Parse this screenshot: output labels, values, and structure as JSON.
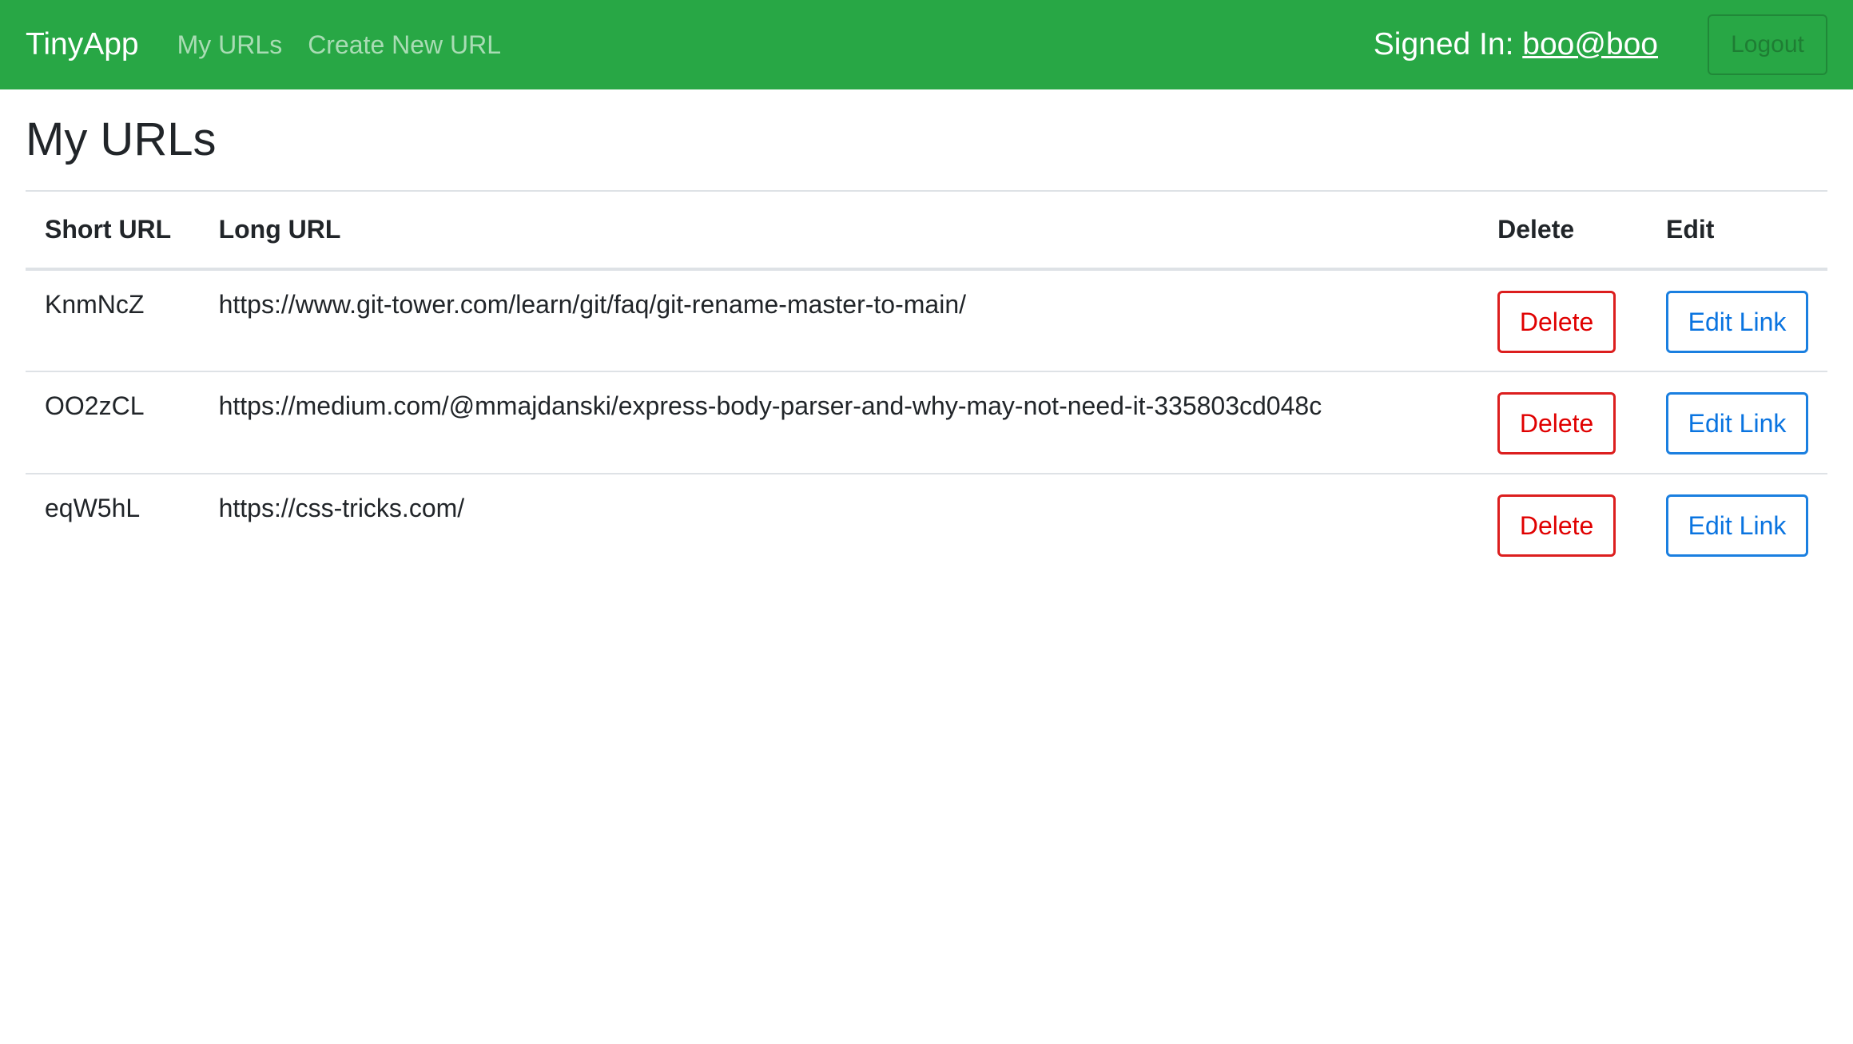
{
  "navbar": {
    "brand": "TinyApp",
    "links": [
      "My URLs",
      "Create New URL"
    ],
    "signed_in_label": "Signed In:",
    "user": "boo@boo",
    "logout_label": "Logout"
  },
  "main": {
    "title": "My URLs",
    "table": {
      "headers": [
        "Short URL",
        "Long URL",
        "Delete",
        "Edit"
      ],
      "rows": [
        {
          "short_url": "KnmNcZ",
          "long_url": "https://www.git-tower.com/learn/git/faq/git-rename-master-to-main/",
          "delete_label": "Delete",
          "edit_label": "Edit Link"
        },
        {
          "short_url": "OO2zCL",
          "long_url": "https://medium.com/@mmajdanski/express-body-parser-and-why-may-not-need-it-335803cd048c",
          "delete_label": "Delete",
          "edit_label": "Edit Link"
        },
        {
          "short_url": "eqW5hL",
          "long_url": "https://css-tricks.com/",
          "delete_label": "Delete",
          "edit_label": "Edit Link"
        }
      ]
    }
  },
  "colors": {
    "navbar_bg": "#28a745",
    "delete": "#e00000",
    "edit": "#0a74e0"
  }
}
